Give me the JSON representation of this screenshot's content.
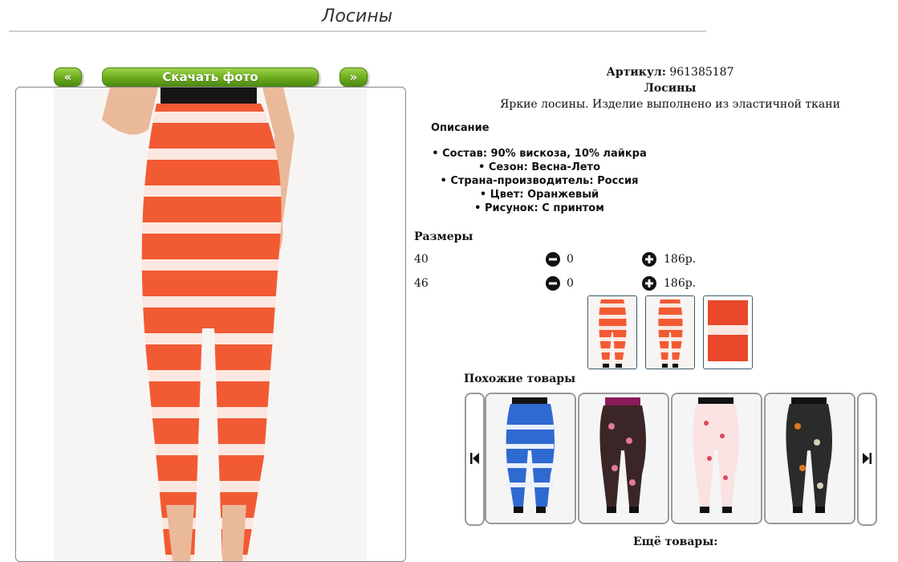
{
  "page": {
    "title": "Лосины"
  },
  "gallery": {
    "prev_label": "«",
    "download_label": "Скачать фото",
    "next_label": "»"
  },
  "product": {
    "sku_label": "Артикул:",
    "sku_value": "961385187",
    "name": "Лосины",
    "short_description": "Яркие лосины. Изделие выполнено из эластичной ткани"
  },
  "description": {
    "heading": "Описание",
    "properties": [
      "Состав: 90% вискоза, 10% лайкра",
      "Сезон: Весна-Лето",
      "Страна-производитель: Россия",
      "Цвет: Оранжевый",
      "Рисунок: С принтом"
    ]
  },
  "sizes": {
    "heading": "Размеры",
    "rows": [
      {
        "size": "40",
        "qty": "0",
        "price": "186р."
      },
      {
        "size": "46",
        "qty": "0",
        "price": "186р."
      }
    ]
  },
  "similar": {
    "heading": "Похожие товары",
    "items": [
      "blue-white tie-dye leggings",
      "black floral pants",
      "white floral pants",
      "black camo pants"
    ]
  },
  "more": {
    "heading": "Ещё товары:"
  },
  "icons": {
    "minus": "minus-circle-icon",
    "plus": "plus-circle-icon",
    "carousel_prev": "skip-back-icon",
    "carousel_next": "skip-forward-icon"
  },
  "colors": {
    "button_green": "#6fae1f",
    "product_orange": "#f0552e",
    "thumb_border": "#3c5a6c"
  }
}
